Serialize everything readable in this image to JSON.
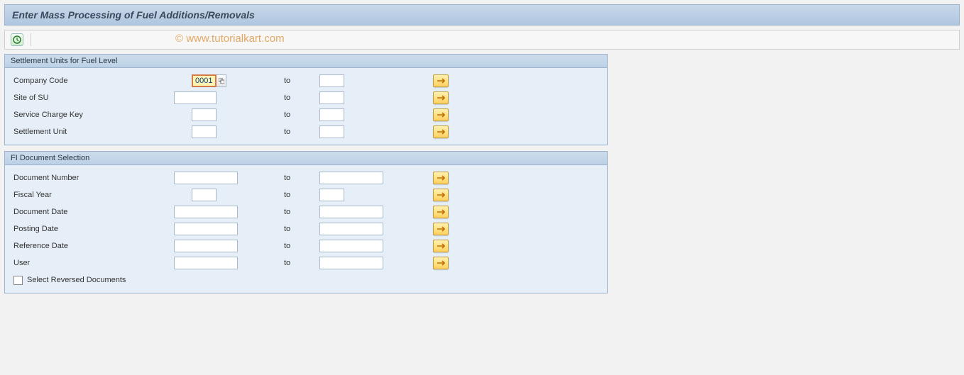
{
  "title": "Enter Mass Processing of Fuel Additions/Removals",
  "watermark": "© www.tutorialkart.com",
  "to_label": "to",
  "group1": {
    "header": "Settlement Units for Fuel Level",
    "rows": [
      {
        "label": "Company Code",
        "from": "0001"
      },
      {
        "label": "Site of SU",
        "from": ""
      },
      {
        "label": "Service Charge Key",
        "from": ""
      },
      {
        "label": "Settlement Unit",
        "from": ""
      }
    ]
  },
  "group2": {
    "header": "FI Document Selection",
    "rows": [
      {
        "label": "Document Number",
        "from": ""
      },
      {
        "label": "Fiscal Year",
        "from": ""
      },
      {
        "label": "Document Date",
        "from": ""
      },
      {
        "label": "Posting Date",
        "from": ""
      },
      {
        "label": "Reference Date",
        "from": ""
      },
      {
        "label": "User",
        "from": ""
      }
    ],
    "checkbox_label": "Select Reversed Documents"
  }
}
